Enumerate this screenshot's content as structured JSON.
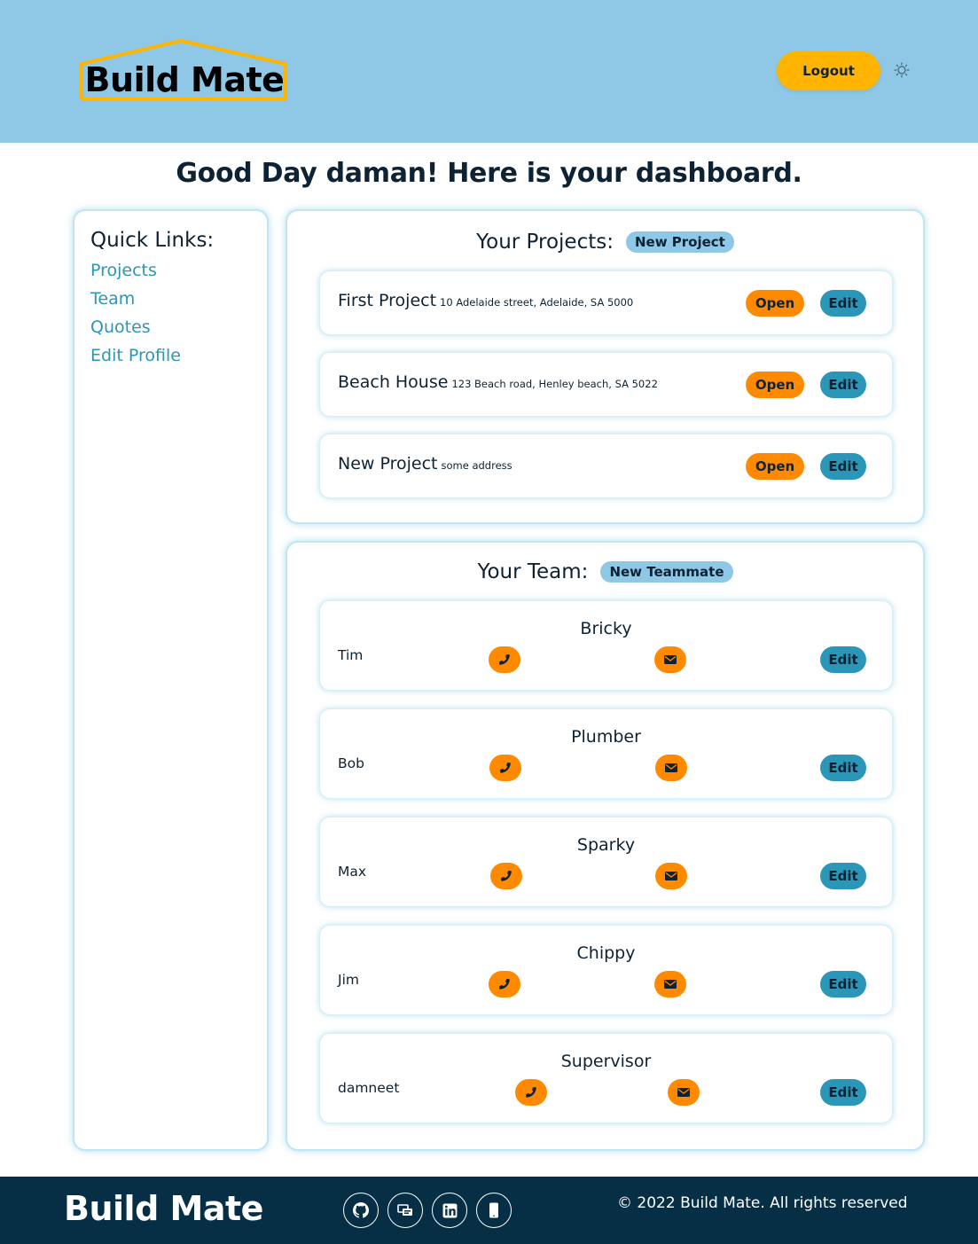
{
  "header": {
    "logo_text": "Build Mate",
    "logout_label": "Logout",
    "theme_icon": "sun-icon"
  },
  "greeting": "Good Day daman! Here is your dashboard.",
  "quick_links": {
    "title": "Quick Links:",
    "items": [
      "Projects",
      "Team",
      "Quotes",
      "Edit Profile"
    ]
  },
  "projects": {
    "title": "Your Projects:",
    "new_label": "New Project",
    "items": [
      {
        "name": "First Project",
        "address": "10 Adelaide street, Adelaide, SA 5000",
        "open": "Open",
        "edit": "Edit"
      },
      {
        "name": "Beach House",
        "address": "123 Beach road, Henley beach, SA 5022",
        "open": "Open",
        "edit": "Edit"
      },
      {
        "name": "New Project",
        "address": "some address",
        "open": "Open",
        "edit": "Edit"
      }
    ]
  },
  "team": {
    "title": "Your Team:",
    "new_label": "New Teammate",
    "items": [
      {
        "role": "Bricky",
        "name": "Tim",
        "edit": "Edit"
      },
      {
        "role": "Plumber",
        "name": "Bob",
        "edit": "Edit"
      },
      {
        "role": "Sparky",
        "name": "Max",
        "edit": "Edit"
      },
      {
        "role": "Chippy",
        "name": "Jim",
        "edit": "Edit"
      },
      {
        "role": "Supervisor",
        "name": "damneet",
        "edit": "Edit"
      }
    ]
  },
  "footer": {
    "brand": "Build Mate",
    "social_icons": [
      "github-icon",
      "portfolio-icon",
      "linkedin-icon",
      "mobile-phone-icon"
    ],
    "copyright": "© 2022 Build Mate. All rights reserved"
  },
  "colors": {
    "header_bg": "#8ec8e6",
    "accent_yellow": "#ffb400",
    "accent_orange": "#ff8a00",
    "accent_teal": "#2a96b8",
    "footer_bg": "#062f45"
  }
}
